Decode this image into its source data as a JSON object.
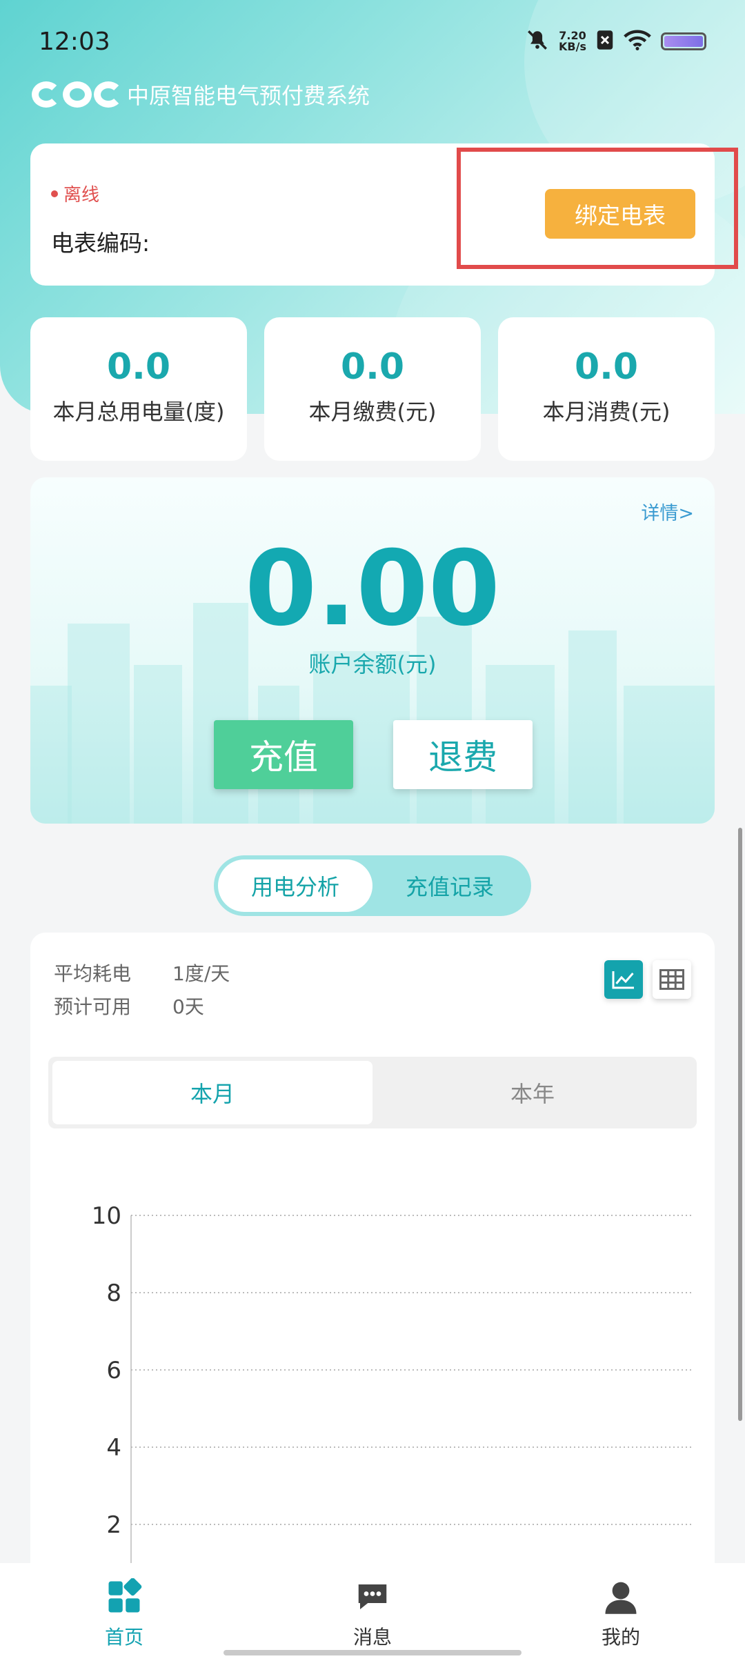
{
  "status_bar": {
    "time": "12:03",
    "net_speed": "7.20",
    "net_unit": "KB/s"
  },
  "app": {
    "title": "中原智能电气预付费系统"
  },
  "meter": {
    "status": "离线",
    "code_label": "电表编码:",
    "bind_button": "绑定电表"
  },
  "stats": [
    {
      "value": "0.0",
      "label": "本月总用电量(度)"
    },
    {
      "value": "0.0",
      "label": "本月缴费(元)"
    },
    {
      "value": "0.0",
      "label": "本月消费(元)"
    }
  ],
  "balance": {
    "details_link": "详情>",
    "value": "0.00",
    "label": "账户余额(元)",
    "recharge_button": "充值",
    "refund_button": "退费"
  },
  "segmented": {
    "items": [
      "用电分析",
      "充值记录"
    ]
  },
  "analysis": {
    "avg_label": "平均耗电",
    "avg_value": "1度/天",
    "forecast_label": "预计可用",
    "forecast_value": "0天",
    "period_tabs": [
      "本月",
      "本年"
    ]
  },
  "chart_data": {
    "type": "line",
    "title": "",
    "xlabel": "",
    "ylabel": "",
    "ylim": [
      0,
      10
    ],
    "y_ticks": [
      "10",
      "8",
      "6",
      "4",
      "2"
    ],
    "grid": true,
    "series": []
  },
  "nav": {
    "items": [
      {
        "label": "首页",
        "icon": "home-grid-icon"
      },
      {
        "label": "消息",
        "icon": "message-icon"
      },
      {
        "label": "我的",
        "icon": "user-icon"
      }
    ]
  },
  "colors": {
    "accent": "#13a9b2",
    "bind_button": "#f6b13e",
    "recharge_button": "#4fcf99",
    "highlight": "#e14b4b",
    "offline": "#e0504f"
  }
}
